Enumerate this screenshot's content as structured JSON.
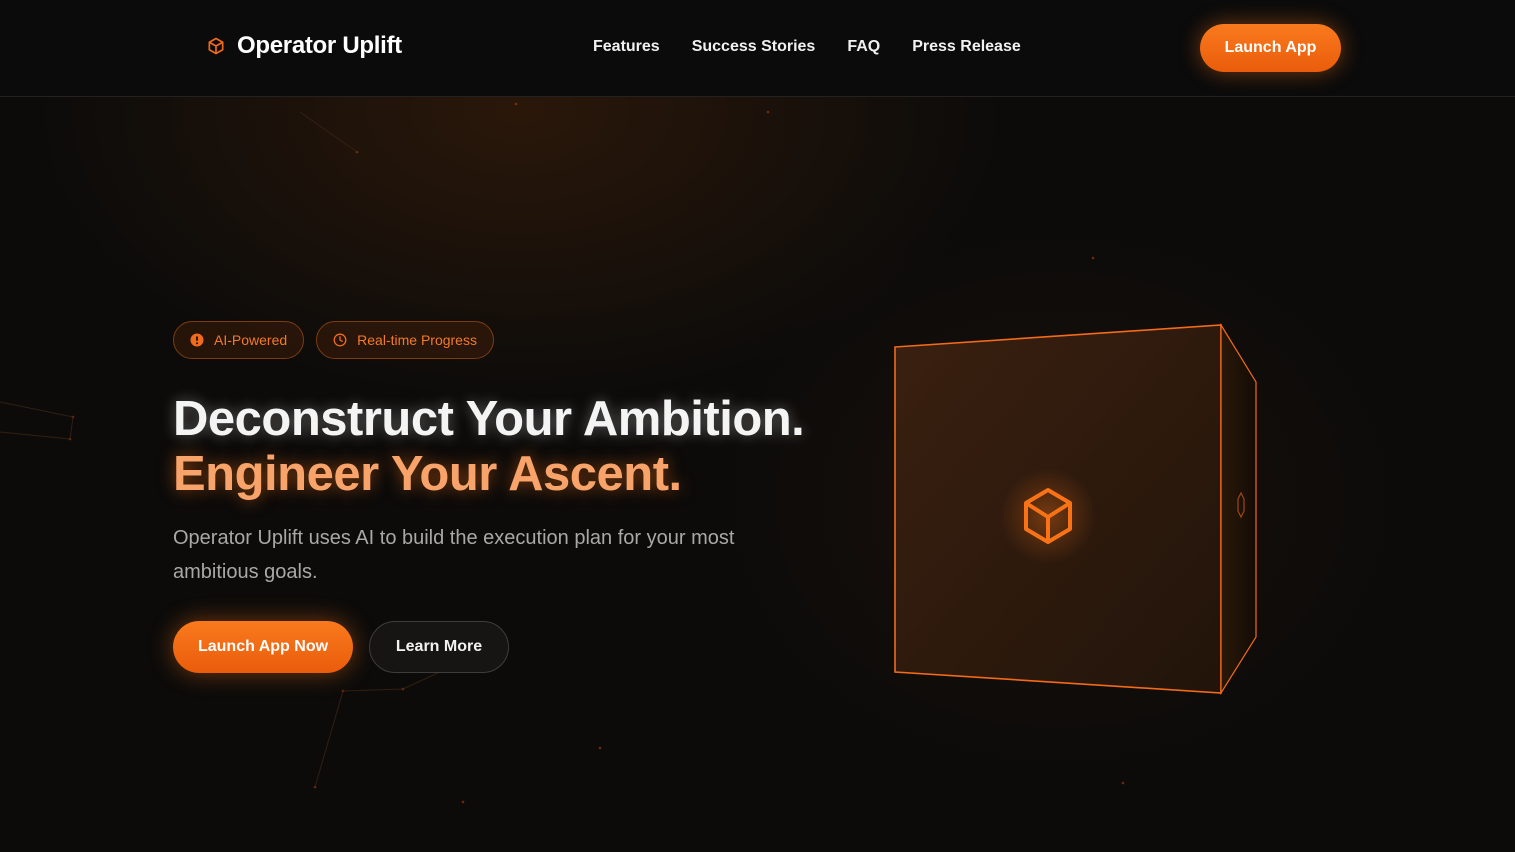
{
  "header": {
    "brand_name": "Operator Uplift",
    "brand_icon": "hexagon-cube-icon",
    "nav": [
      {
        "label": "Features"
      },
      {
        "label": "Success Stories"
      },
      {
        "label": "FAQ"
      },
      {
        "label": "Press Release"
      }
    ],
    "cta_label": "Launch App"
  },
  "hero": {
    "badges": [
      {
        "label": "AI-Powered",
        "icon": "alert-circle-icon"
      },
      {
        "label": "Real-time Progress",
        "icon": "clock-icon"
      }
    ],
    "title_line1": "Deconstruct Your Ambition.",
    "title_line2": "Engineer Your Ascent.",
    "description": "Operator Uplift uses AI to build the execution plan for your most ambitious goals.",
    "primary_button": "Launch App Now",
    "secondary_button": "Learn More",
    "cube_icon": "cube-icon"
  },
  "colors": {
    "accent": "#f97316",
    "accent_light": "#f7a36a",
    "background": "#0c0b0a"
  }
}
